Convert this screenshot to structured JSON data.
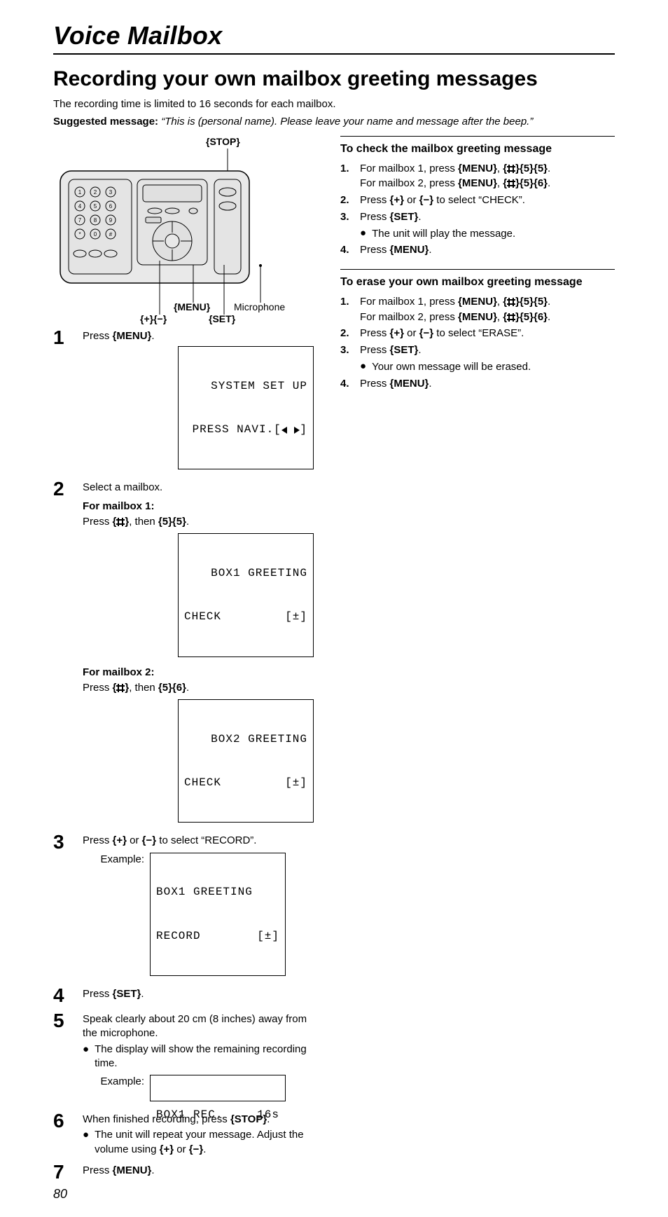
{
  "chapter": "Voice Mailbox",
  "section": "Recording your own mailbox greeting messages",
  "intro": "The recording time is limited to 16 seconds for each mailbox.",
  "suggested_label": "Suggested message:",
  "suggested_msg": "“This is (personal name). Please leave your name and message after the beep.”",
  "device": {
    "stop": "STOP",
    "menu": "MENU",
    "set": "SET",
    "microphone": "Microphone",
    "plus": "+",
    "minus": "−"
  },
  "lcd1": {
    "line1": "SYSTEM SET UP",
    "line2_left": "PRESS NAVI.[",
    "line2_right": "]"
  },
  "lcd_box1": {
    "line1": "BOX1 GREETING",
    "line2_left": "CHECK",
    "line2_right": "[±]"
  },
  "lcd_box2": {
    "line1": "BOX2 GREETING",
    "line2_left": "CHECK",
    "line2_right": "[±]"
  },
  "lcd_record": {
    "line1": "BOX1 GREETING",
    "line2_left": "RECORD",
    "line2_right": "[±]"
  },
  "lcd_rec_time": {
    "left": "BOX1 REC.",
    "right": "16s"
  },
  "example_label": "Example:",
  "steps": {
    "s1": "Press ",
    "s1_menu": "MENU",
    "s2": "Select a mailbox.",
    "s2_mb1_head": "For mailbox 1:",
    "s2_mb1_line_a": "Press ",
    "s2_mb1_line_b": ", then ",
    "s2_mb1_k1": "5",
    "s2_mb1_k2": "5",
    "s2_mb2_head": "For mailbox 2:",
    "s2_mb2_k1": "5",
    "s2_mb2_k2": "6",
    "s3_a": "Press ",
    "s3_b": " or ",
    "s3_c": " to select “RECORD”.",
    "s4_a": "Press ",
    "s4_set": "SET",
    "s5": "Speak clearly about 20 cm (8 inches) away from the microphone.",
    "s5_bullet": "The display will show the remaining recording time.",
    "s6_a": "When finished recording, press ",
    "s6_stop": "STOP",
    "s6_bullet_a": "The unit will repeat your message. Adjust the volume using ",
    "s6_bullet_b": " or ",
    "s7_a": "Press ",
    "s7_menu": "MENU"
  },
  "right": {
    "check_head": "To check the mailbox greeting message",
    "erase_head": "To erase your own mailbox greeting message",
    "r1_a": "For mailbox 1, press ",
    "r1_b": "For mailbox 2, press ",
    "menu": "MENU",
    "k55a": "5",
    "k55b": "5",
    "k56a": "5",
    "k56b": "6",
    "r2_a": "Press ",
    "r2_b": " or ",
    "r2_check": " to select “CHECK”.",
    "r2_erase": " to select “ERASE”.",
    "r3": "Press ",
    "set": "SET",
    "r3_bullet_play": "The unit will play the message.",
    "r3_bullet_erase": "Your own message will be erased.",
    "r4": "Press "
  },
  "page_number": "80"
}
